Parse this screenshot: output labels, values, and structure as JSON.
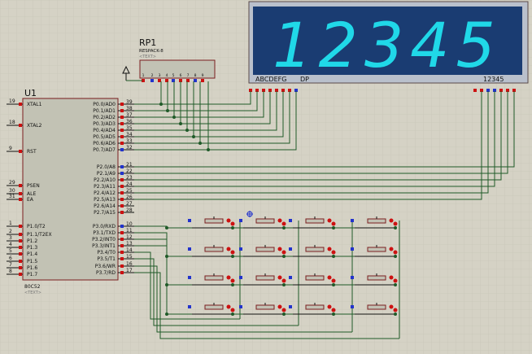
{
  "mcu": {
    "ref": "U1",
    "part": "80C52",
    "text_tag": "<TEXT>",
    "left_pins": [
      {
        "num": "19",
        "label": "XTAL1"
      },
      {
        "num": "18",
        "label": "XTAL2"
      },
      {
        "num": "9",
        "label": "RST"
      },
      {
        "num": "29",
        "label": "PSEN"
      },
      {
        "num": "30",
        "label": "ALE"
      },
      {
        "num": "31",
        "label": "EA"
      },
      {
        "num": "1",
        "label": "P1.0/T2"
      },
      {
        "num": "2",
        "label": "P1.1/T2EX"
      },
      {
        "num": "3",
        "label": "P1.2"
      },
      {
        "num": "4",
        "label": "P1.3"
      },
      {
        "num": "5",
        "label": "P1.4"
      },
      {
        "num": "6",
        "label": "P1.5"
      },
      {
        "num": "7",
        "label": "P1.6"
      },
      {
        "num": "8",
        "label": "P1.7"
      }
    ],
    "p0_pins": [
      {
        "num": "39",
        "label": "P0.0/AD0"
      },
      {
        "num": "38",
        "label": "P0.1/AD1"
      },
      {
        "num": "37",
        "label": "P0.2/AD2"
      },
      {
        "num": "36",
        "label": "P0.3/AD3"
      },
      {
        "num": "35",
        "label": "P0.4/AD4"
      },
      {
        "num": "34",
        "label": "P0.5/AD5"
      },
      {
        "num": "33",
        "label": "P0.6/AD6"
      },
      {
        "num": "32",
        "label": "P0.7/AD7"
      }
    ],
    "p2_pins": [
      {
        "num": "21",
        "label": "P2.0/A8"
      },
      {
        "num": "22",
        "label": "P2.1/A9"
      },
      {
        "num": "23",
        "label": "P2.2/A10"
      },
      {
        "num": "24",
        "label": "P2.3/A11"
      },
      {
        "num": "25",
        "label": "P2.4/A12"
      },
      {
        "num": "26",
        "label": "P2.5/A13"
      },
      {
        "num": "27",
        "label": "P2.6/A14"
      },
      {
        "num": "28",
        "label": "P2.7/A15"
      }
    ],
    "p3_pins": [
      {
        "num": "10",
        "label": "P3.0/RXD"
      },
      {
        "num": "11",
        "label": "P3.1/TXD"
      },
      {
        "num": "12",
        "label": "P3.2/INT0"
      },
      {
        "num": "13",
        "label": "P3.3/INT1"
      },
      {
        "num": "14",
        "label": "P3.4/T0"
      },
      {
        "num": "15",
        "label": "P3.5/T1"
      },
      {
        "num": "16",
        "label": "P3.6/WR"
      },
      {
        "num": "17",
        "label": "P3.7/RD"
      }
    ]
  },
  "resistor_pack": {
    "ref": "RP1",
    "part": "RESPACK-8",
    "text_tag": "<TEXT>",
    "pin_labels": [
      "1",
      "2",
      "3",
      "4",
      "5",
      "6",
      "7",
      "8",
      "9"
    ]
  },
  "display": {
    "digits": "12345",
    "segment_label": "ABCDEFG",
    "dp_label": "DP",
    "common_label": "12345",
    "digit_color": "#20d8e8",
    "panel_color": "#1a3c72"
  },
  "keypad": {
    "rows": 4,
    "cols": 4
  },
  "colors": {
    "background": "#d5d2c5",
    "wire": "#1f5a28",
    "component_body": "#c2c2b4",
    "outline": "#7a1f1f",
    "pin_red": "#cc1111",
    "pin_blue": "#2233cc"
  }
}
